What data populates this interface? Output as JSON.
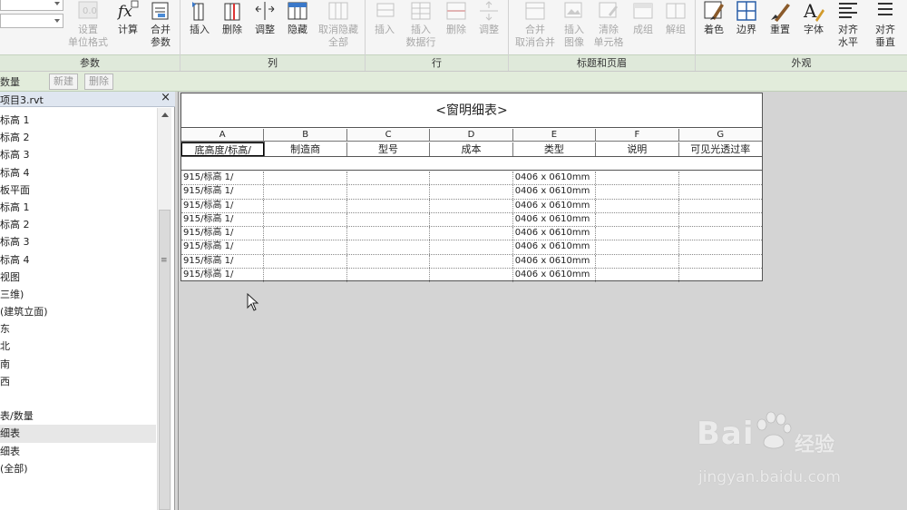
{
  "ribbon": {
    "groups": {
      "params": {
        "title": "参数",
        "buttons": [
          {
            "label": "设置\n单位格式",
            "icon": "units-format-icon"
          },
          {
            "label": "计算",
            "icon": "fx-calculate-icon"
          },
          {
            "label": "合并\n参数",
            "icon": "combine-params-icon"
          }
        ]
      },
      "columns": {
        "title": "列",
        "buttons": [
          {
            "label": "插入",
            "icon": "insert-column-icon"
          },
          {
            "label": "删除",
            "icon": "delete-column-icon"
          },
          {
            "label": "调整",
            "icon": "resize-column-icon"
          },
          {
            "label": "隐藏",
            "icon": "hide-column-icon"
          },
          {
            "label": "取消隐藏\n全部",
            "icon": "unhide-all-icon"
          }
        ]
      },
      "rows": {
        "title": "行",
        "buttons": [
          {
            "label": "插入",
            "icon": "insert-row-icon"
          },
          {
            "label": "插入\n数据行",
            "icon": "insert-data-row-icon"
          },
          {
            "label": "删除",
            "icon": "delete-row-icon"
          },
          {
            "label": "调整",
            "icon": "resize-row-icon"
          }
        ]
      },
      "titles": {
        "title": "标题和页眉",
        "buttons": [
          {
            "label": "合并\n取消合并",
            "icon": "merge-unmerge-icon"
          },
          {
            "label": "插入\n图像",
            "icon": "insert-image-icon"
          },
          {
            "label": "清除\n单元格",
            "icon": "clear-cell-icon"
          },
          {
            "label": "成组",
            "icon": "group-icon"
          },
          {
            "label": "解组",
            "icon": "ungroup-icon"
          }
        ]
      },
      "appearance": {
        "title": "外观",
        "buttons": [
          {
            "label": "着色",
            "icon": "shading-brush-icon"
          },
          {
            "label": "边界",
            "icon": "borders-grid-icon"
          },
          {
            "label": "重置",
            "icon": "reset-brush-icon"
          },
          {
            "label": "字体",
            "icon": "font-icon"
          },
          {
            "label": "对齐\n水平",
            "icon": "align-horizontal-icon"
          },
          {
            "label": "对齐\n垂直",
            "icon": "align-vertical-icon"
          }
        ]
      }
    }
  },
  "optbar": {
    "label": "数量",
    "new_label": "新建",
    "delete_label": "删除"
  },
  "browser": {
    "title": "项目3.rvt",
    "close": "×",
    "items": [
      "标高 1",
      "标高 2",
      "标高 3",
      "标高 4",
      "板平面",
      "标高 1",
      "标高 2",
      "标高 3",
      "标高 4",
      "视图",
      "三维)",
      "(建筑立面)",
      "东",
      "北",
      "南",
      "西",
      "",
      "表/数量",
      "细表",
      "细表",
      "(全部)"
    ],
    "selected_index": 18
  },
  "schedule": {
    "title": "<窗明细表>",
    "letters": [
      "A",
      "B",
      "C",
      "D",
      "E",
      "F",
      "G"
    ],
    "headers": [
      "底高度/标高/",
      "制造商",
      "型号",
      "成本",
      "类型",
      "说明",
      "可见光透过率"
    ],
    "rows": [
      [
        "915/标高 1/",
        "",
        "",
        "",
        "0406 x 0610mm",
        "",
        ""
      ],
      [
        "915/标高 1/",
        "",
        "",
        "",
        "0406 x 0610mm",
        "",
        ""
      ],
      [
        "915/标高 1/",
        "",
        "",
        "",
        "0406 x 0610mm",
        "",
        ""
      ],
      [
        "915/标高 1/",
        "",
        "",
        "",
        "0406 x 0610mm",
        "",
        ""
      ],
      [
        "915/标高 1/",
        "",
        "",
        "",
        "0406 x 0610mm",
        "",
        ""
      ],
      [
        "915/标高 1/",
        "",
        "",
        "",
        "0406 x 0610mm",
        "",
        ""
      ],
      [
        "915/标高 1/",
        "",
        "",
        "",
        "0406 x 0610mm",
        "",
        ""
      ],
      [
        "915/标高 1/",
        "",
        "",
        "",
        "0406 x 0610mm",
        "",
        ""
      ]
    ]
  },
  "watermark": {
    "brand": "Bai",
    "brand_tail": "经验",
    "url": "jingyan.baidu.com"
  }
}
